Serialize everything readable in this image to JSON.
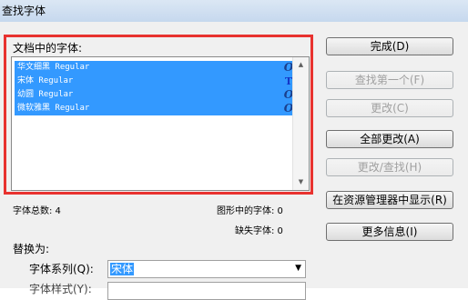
{
  "window": {
    "title": "查找字体"
  },
  "fonts_panel": {
    "label": "文档中的字体:",
    "items": [
      {
        "name": "华文细黑 Regular",
        "icon": "opentype-font-icon",
        "glyph": "O"
      },
      {
        "name": "宋体 Regular",
        "icon": "truetype-font-icon",
        "glyph": "T"
      },
      {
        "name": "幼圆 Regular",
        "icon": "opentype-font-icon",
        "glyph": "O"
      },
      {
        "name": "微软雅黑 Regular",
        "icon": "opentype-font-icon",
        "glyph": "O"
      }
    ],
    "selection_color": "#3399ff"
  },
  "stats": {
    "total": "字体总数: 4",
    "in_graphics": "图形中的字体: 0",
    "missing": "缺失字体: 0"
  },
  "buttons": {
    "done": "完成(D)",
    "find_first": "查找第一个(F)",
    "change": "更改(C)",
    "change_all": "全部更改(A)",
    "change_find": "更改/查找(H)",
    "reveal_in_explorer": "在资源管理器中显示(R)",
    "more_info": "更多信息(I)"
  },
  "replace": {
    "label": "替换为:",
    "family_label": "字体系列(Q):",
    "family_value": "宋体",
    "style_label": "字体样式(Y):"
  },
  "colors": {
    "highlight_border": "#e8322f"
  }
}
